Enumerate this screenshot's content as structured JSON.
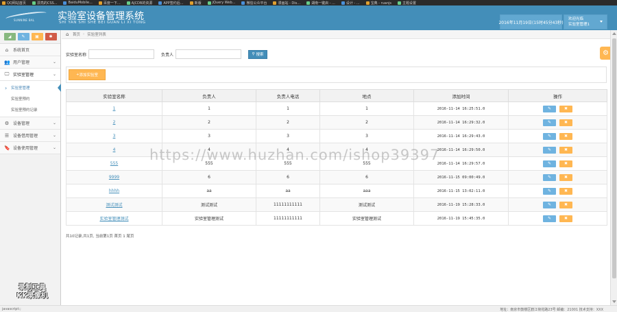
{
  "bookmarks": [
    "QQ网站首页",
    "漂亮的CSS...",
    "BaiduMobile...",
    "百度一下...",
    "AJCDB的资源",
    "APP签约后...",
    "新版",
    "jQuery Web...",
    "微信公众平台",
    "漫画站 - Dis...",
    "湖南一键启 - ...",
    "设计 - ...",
    "宝典 - ruanjs",
    "主题设置"
  ],
  "header": {
    "logo_text": "SUNNINE BAL",
    "title": "实验室设备管理系统",
    "subtitle": "SHI YAN SHI SHE BEI GUAN LI XI TONG",
    "datetime": "2016年11月19日(15时45分43秒)",
    "user_greeting": "欢迎光临",
    "user_name": "实验室管理1"
  },
  "sidebar": {
    "items": [
      {
        "label": "系统首页",
        "icon": "⌂"
      },
      {
        "label": "用户管理",
        "icon": "👥"
      },
      {
        "label": "实验室管理",
        "icon": "🖵"
      },
      {
        "label": "设备管理",
        "icon": "⚙"
      },
      {
        "label": "设备借用管理",
        "icon": "☰"
      },
      {
        "label": "设备使用管理",
        "icon": "🔖"
      }
    ],
    "subitems": [
      "实验室管理",
      "实验室预约",
      "实验室预约记录"
    ]
  },
  "breadcrumb": {
    "home": "首页",
    "current": "实验室列表"
  },
  "search": {
    "name_label": "实验室名称",
    "owner_label": "负责人",
    "button": "搜索"
  },
  "add_button": "添加实验室",
  "table": {
    "headers": [
      "实验室名称",
      "负责人",
      "负责人电话",
      "地点",
      "添加时间",
      "操作"
    ],
    "rows": [
      [
        "1",
        "1",
        "1",
        "1",
        "2016-11-14 16:25:51.0"
      ],
      [
        "2",
        "2",
        "2",
        "2",
        "2016-11-14 16:29:32.0"
      ],
      [
        "3",
        "3",
        "3",
        "3",
        "2016-11-14 16:29:43.0"
      ],
      [
        "4",
        "4",
        "4",
        "4",
        "2016-11-14 16:29:50.0"
      ],
      [
        "555",
        "555",
        "555",
        "555",
        "2016-11-14 16:29:57.0"
      ],
      [
        "9999",
        "6",
        "6",
        "6",
        "2016-11-15 09:00:49.0"
      ],
      [
        "hhhh",
        "aa",
        "aa",
        "aaa",
        "2016-11-15 13:02:11.0"
      ],
      [
        "测试测试",
        "测试测试",
        "11111111111",
        "测试测试",
        "2016-11-19 15:28:33.0"
      ],
      [
        "实验室管理测试",
        "实验室管理测试",
        "11111111111",
        "实验室管理测试",
        "2016-11-19 15:45:35.0"
      ]
    ]
  },
  "pager": "共10记录,共1页, 当前第1页 首页 1 尾页",
  "badge": {
    "line1": "录制工具",
    "line2": "KK录像机"
  },
  "watermark": "https://www.huzhan.com/ishop39397",
  "statusbar": {
    "left": "javascript:;",
    "right": "地址：南京市鼓楼区鹤江荷花路23号 邮编：21001  技术支持：XXX"
  },
  "colors": {
    "primary": "#438eb9",
    "edit": "#6fb3e0",
    "delete": "#ffb752"
  }
}
